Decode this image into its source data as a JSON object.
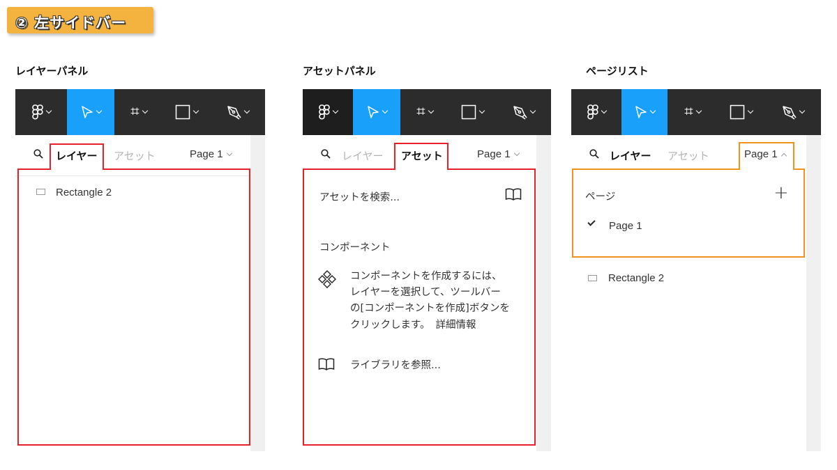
{
  "badge": {
    "label": "② 左サイドバー"
  },
  "panels": {
    "layers": {
      "title": "レイヤーパネル",
      "tab_layers": "レイヤー",
      "tab_assets": "アセット",
      "page_selector": "Page 1",
      "row": "Rectangle 2"
    },
    "assets": {
      "title": "アセットパネル",
      "tab_layers": "レイヤー",
      "tab_assets": "アセット",
      "page_selector": "Page 1",
      "search_placeholder": "アセットを検索...",
      "components_heading": "コンポーネント",
      "components_help_1": "コンポーネントを作成するには、",
      "components_help_2": "レイヤーを選択して、ツールバー",
      "components_help_3": "の[コンポーネントを作成]ボタンを",
      "components_help_4": "クリックします。",
      "learn_more": "詳細情報",
      "browse_libraries": "ライブラリを参照..."
    },
    "pages": {
      "title": "ページリスト",
      "tab_layers": "レイヤー",
      "tab_assets": "アセット",
      "page_selector": "Page 1",
      "pages_heading": "ページ",
      "add_page": "+",
      "current_page": "Page 1",
      "row": "Rectangle 2"
    }
  },
  "colors": {
    "toolbar_bg": "#2c2c2c",
    "active_tool": "#18a0fb",
    "highlight_red": "#e8202a",
    "highlight_orange": "#f0941e",
    "link": "#18a0fb",
    "badge_bg": "#f4b33f"
  },
  "toolbar_icons": [
    "figma-menu-icon",
    "move-tool-icon",
    "frame-tool-icon",
    "shape-tool-icon",
    "pen-tool-icon"
  ]
}
